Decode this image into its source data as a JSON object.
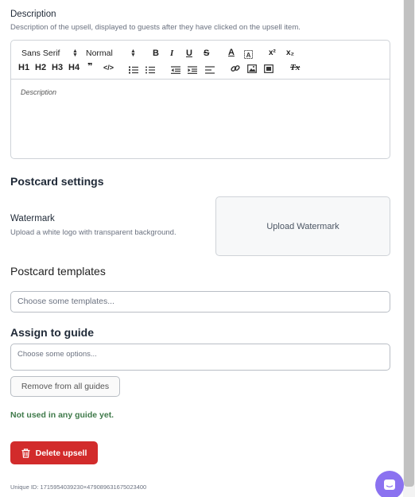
{
  "description": {
    "label": "Description",
    "help": "Description of the upsell, displayed to guests after they have clicked on the upsell item.",
    "placeholder": "Description"
  },
  "toolbar": {
    "font_family": "Sans Serif",
    "font_size": "Normal",
    "bold": "B",
    "italic": "I",
    "underline": "U",
    "strike": "S",
    "text_color": "A",
    "superscript": "x²",
    "subscript": "x₂",
    "h1": "H1",
    "h2": "H2",
    "h3": "H3",
    "h4": "H4",
    "blockquote": "❞",
    "code": "</>",
    "clean": "Tx"
  },
  "postcard": {
    "title": "Postcard settings",
    "watermark_label": "Watermark",
    "watermark_help": "Upload a white logo with transparent background.",
    "upload_button": "Upload Watermark",
    "templates_title": "Postcard templates",
    "templates_placeholder": "Choose some templates..."
  },
  "guide": {
    "title": "Assign to guide",
    "options_placeholder": "Choose some options...",
    "remove_button": "Remove from all guides",
    "status": "Not used in any guide yet."
  },
  "delete_button": "Delete upsell",
  "unique_id": "Unique ID: 1715954039230×479089631675023400",
  "icons": {
    "trash": "trash-icon",
    "chat": "chat-icon",
    "link": "link-icon",
    "image": "image-icon",
    "video": "video-icon"
  },
  "colors": {
    "danger": "#d22b2b",
    "success_text": "#3f7a4a",
    "chat_bubble": "#8b72f0"
  }
}
